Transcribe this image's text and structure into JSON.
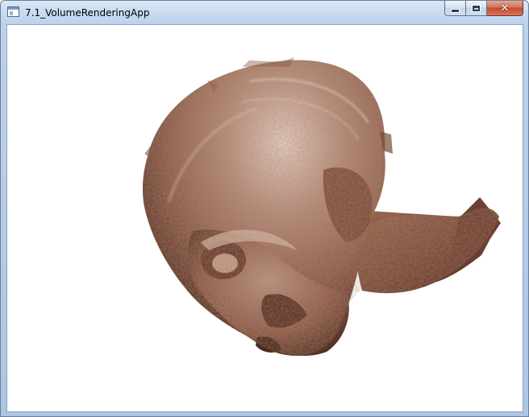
{
  "window": {
    "title": "7.1_VolumeRenderingApp",
    "app_icon": "window-app-icon",
    "controls": {
      "minimize_icon": "minimize-icon",
      "maximize_icon": "maximize-icon",
      "close_icon": "close-icon"
    }
  },
  "viewport": {
    "background": "#ffffff",
    "content": "volume-rendered-head",
    "palette": {
      "dark": "#4a2a1f",
      "mid": "#8c5a47",
      "light": "#c9a695",
      "highlight": "#e4cfc4"
    }
  }
}
